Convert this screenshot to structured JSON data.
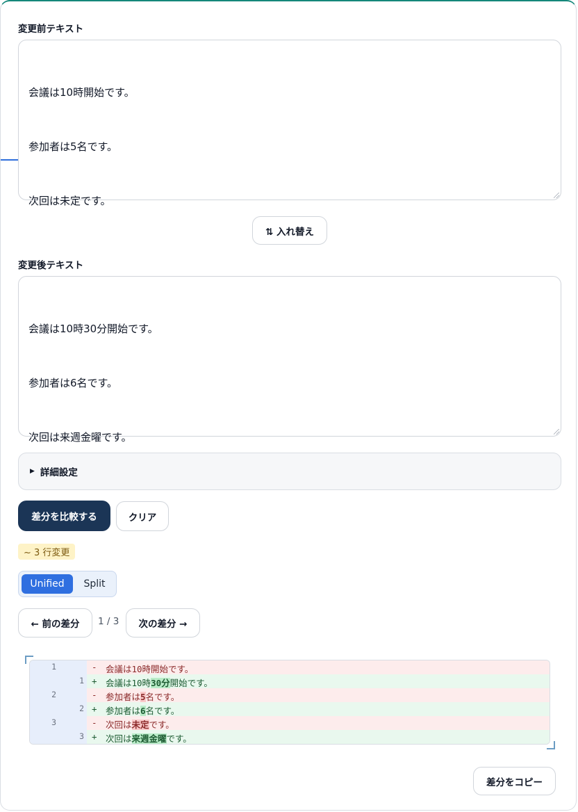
{
  "before": {
    "label": "変更前テキスト",
    "lines": [
      "会議は10時開始です。",
      "参加者は5名です。",
      "次回は未定です。"
    ]
  },
  "swap_label": "⇅ 入れ替え",
  "after": {
    "label": "変更後テキスト",
    "lines": [
      "会議は10時30分開始です。",
      "参加者は6名です。",
      "次回は来週金曜です。"
    ]
  },
  "details_label": "詳細設定",
  "compare_label": "差分を比較する",
  "clear_label": "クリア",
  "summary_badge": "~ 3 行変更",
  "view_toggle": {
    "unified": "Unified",
    "split": "Split",
    "selected": "Unified"
  },
  "nav": {
    "prev": "← 前の差分",
    "next": "次の差分 →",
    "position": "1 / 3"
  },
  "diff_rows": [
    {
      "type": "del",
      "old": "1",
      "new": "",
      "sign": "-",
      "parts": [
        [
          "会議は10時開始です。",
          false
        ]
      ]
    },
    {
      "type": "add",
      "old": "",
      "new": "1",
      "sign": "+",
      "parts": [
        [
          "会議は10時",
          false
        ],
        [
          "30分",
          true
        ],
        [
          "開始です。",
          false
        ]
      ]
    },
    {
      "type": "del",
      "old": "2",
      "new": "",
      "sign": "-",
      "parts": [
        [
          "参加者は",
          false
        ],
        [
          "5",
          true
        ],
        [
          "名です。",
          false
        ]
      ]
    },
    {
      "type": "add",
      "old": "",
      "new": "2",
      "sign": "+",
      "parts": [
        [
          "参加者は",
          false
        ],
        [
          "6",
          true
        ],
        [
          "名です。",
          false
        ]
      ]
    },
    {
      "type": "del",
      "old": "3",
      "new": "",
      "sign": "-",
      "parts": [
        [
          "次回は",
          false
        ],
        [
          "未定",
          true
        ],
        [
          "です。",
          false
        ]
      ]
    },
    {
      "type": "add",
      "old": "",
      "new": "3",
      "sign": "+",
      "parts": [
        [
          "次回は",
          false
        ],
        [
          "来週金曜",
          true
        ],
        [
          "です。",
          false
        ]
      ]
    }
  ],
  "copy_label": "差分をコピー",
  "colors": {
    "primary": "#1b3556",
    "toggle_active": "#2f6fe0",
    "accent_top": "#14877a",
    "del_bg": "#fdecec",
    "add_bg": "#e9f8ee"
  }
}
